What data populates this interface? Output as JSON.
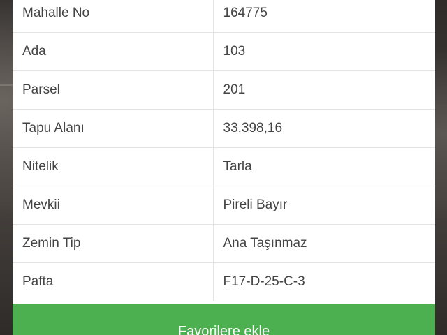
{
  "rows": [
    {
      "label": "Mahalle No",
      "value": "164775"
    },
    {
      "label": "Ada",
      "value": "103"
    },
    {
      "label": "Parsel",
      "value": "201"
    },
    {
      "label": "Tapu Alanı",
      "value": "33.398,16"
    },
    {
      "label": "Nitelik",
      "value": "Tarla"
    },
    {
      "label": "Mevkii",
      "value": "Pireli Bayır"
    },
    {
      "label": "Zemin Tip",
      "value": "Ana Taşınmaz"
    },
    {
      "label": "Pafta",
      "value": "F17-D-25-C-3"
    }
  ],
  "actions": {
    "favorite_label": "Favorilere ekle"
  },
  "colors": {
    "accent": "#4caf50",
    "border": "#e3e3e3",
    "text": "#444444"
  }
}
